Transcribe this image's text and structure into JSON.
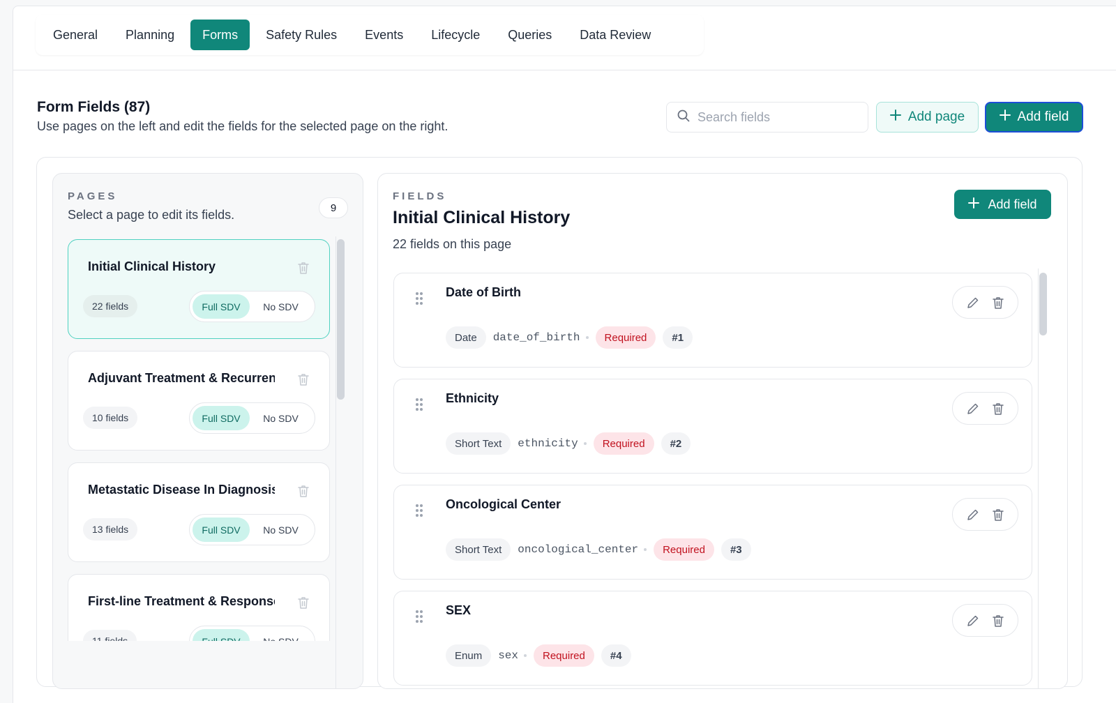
{
  "tabs": [
    {
      "label": "General",
      "active": false
    },
    {
      "label": "Planning",
      "active": false
    },
    {
      "label": "Forms",
      "active": true
    },
    {
      "label": "Safety Rules",
      "active": false
    },
    {
      "label": "Events",
      "active": false
    },
    {
      "label": "Lifecycle",
      "active": false
    },
    {
      "label": "Queries",
      "active": false
    },
    {
      "label": "Data Review",
      "active": false
    }
  ],
  "header": {
    "title": "Form Fields (87)",
    "subtitle": "Use pages on the left and edit the fields for the selected page on the right.",
    "search_placeholder": "Search fields",
    "add_page_label": "Add page",
    "add_field_label": "Add field"
  },
  "pages_panel": {
    "caption": "PAGES",
    "hint": "Select a page to edit its fields.",
    "count": "9",
    "items": [
      {
        "name": "Initial Clinical History",
        "fields": "22 fields",
        "full_sdv": "Full SDV",
        "no_sdv": "No SDV",
        "selected": true
      },
      {
        "name": "Adjuvant Treatment & Recurrence",
        "fields": "10 fields",
        "full_sdv": "Full SDV",
        "no_sdv": "No SDV",
        "selected": false
      },
      {
        "name": "Metastatic Disease In Diagnosis",
        "fields": "13 fields",
        "full_sdv": "Full SDV",
        "no_sdv": "No SDV",
        "selected": false
      },
      {
        "name": "First-line Treatment & Response",
        "fields": "11 fields",
        "full_sdv": "Full SDV",
        "no_sdv": "No SDV",
        "selected": false
      }
    ]
  },
  "fields_panel": {
    "caption": "FIELDS",
    "title": "Initial Clinical History",
    "subtitle": "22 fields on this page",
    "add_field_label": "Add field",
    "items": [
      {
        "label": "Date of Birth",
        "type": "Date",
        "key": "date_of_birth",
        "required": "Required",
        "index": "#1"
      },
      {
        "label": "Ethnicity",
        "type": "Short Text",
        "key": "ethnicity",
        "required": "Required",
        "index": "#2"
      },
      {
        "label": "Oncological Center",
        "type": "Short Text",
        "key": "oncological_center",
        "required": "Required",
        "index": "#3"
      },
      {
        "label": "SEX",
        "type": "Enum",
        "key": "sex",
        "required": "Required",
        "index": "#4"
      }
    ]
  },
  "colors": {
    "accent": "#10877a",
    "required": "#c1121f",
    "selected_border": "#4fd1c0"
  },
  "icons": [
    "search-icon",
    "plus-icon",
    "trash-icon",
    "pencil-icon",
    "drag-handle-icon"
  ]
}
